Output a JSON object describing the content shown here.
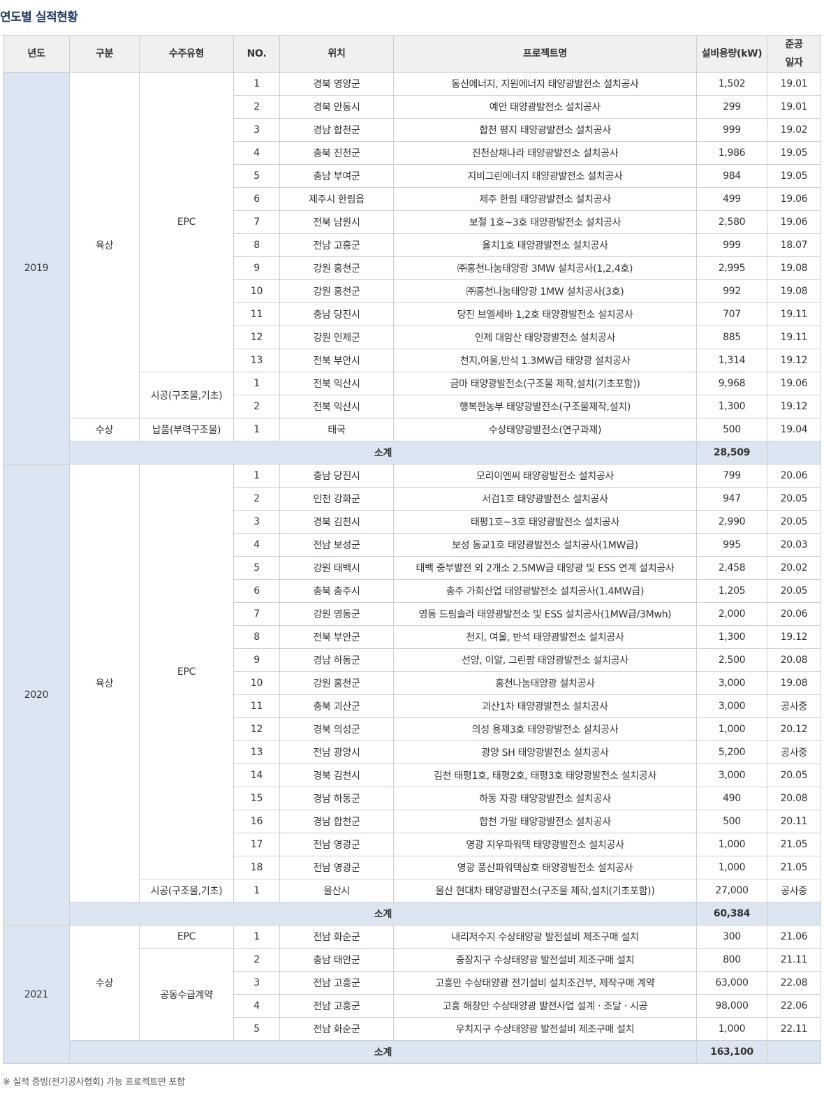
{
  "page": {
    "title": "연도별 실적현황",
    "footnote": "※ 실적 증빙(전기공사협회) 가능 프로젝트만 포함"
  },
  "header": [
    "년도",
    "구분",
    "수주유형",
    "NO.",
    "위치",
    "프로젝트명",
    "설비용량(kW)",
    "준공",
    "일자"
  ],
  "years": [
    {
      "year": "2019",
      "groups": [
        {
          "division": "육상",
          "types": [
            {
              "type": "EPC",
              "rows": [
                {
                  "no": "1",
                  "loc": "경북 영양군",
                  "name": "동신에너지, 지원에너지 태양광발전소 설치공사",
                  "cap": "1,502",
                  "date": "19.01"
                },
                {
                  "no": "2",
                  "loc": "경북 안동시",
                  "name": "예안 태양광발전소 설치공사",
                  "cap": "299",
                  "date": "19.01"
                },
                {
                  "no": "3",
                  "loc": "경남 합천군",
                  "name": "합천 평지 태양광발전소 설치공사",
                  "cap": "999",
                  "date": "19.02"
                },
                {
                  "no": "4",
                  "loc": "충북 진천군",
                  "name": "진천삼채나라 태양광발전소 설치공사",
                  "cap": "1,986",
                  "date": "19.05"
                },
                {
                  "no": "5",
                  "loc": "충남 부여군",
                  "name": "지비그린에너지 태양광발전소 설치공사",
                  "cap": "984",
                  "date": "19.05"
                },
                {
                  "no": "6",
                  "loc": "제주시 한림읍",
                  "name": "제주 한림 태양광발전소 설치공사",
                  "cap": "499",
                  "date": "19.06"
                },
                {
                  "no": "7",
                  "loc": "전북 남원시",
                  "name": "보절 1호~3호 태양광발전소 설치공사",
                  "cap": "2,580",
                  "date": "19.06"
                },
                {
                  "no": "8",
                  "loc": "전남 고흥군",
                  "name": "율치1호 태양광발전소 설치공사",
                  "cap": "999",
                  "date": "18.07"
                },
                {
                  "no": "9",
                  "loc": "강원 홍천군",
                  "name": "㈜홍천나눔태양광 3MW 설치공사(1,2,4호)",
                  "cap": "2,995",
                  "date": "19.08"
                },
                {
                  "no": "10",
                  "loc": "강원 홍천군",
                  "name": "㈜홍천나눔태양광 1MW 설치공사(3호)",
                  "cap": "992",
                  "date": "19.08"
                },
                {
                  "no": "11",
                  "loc": "충남 당진시",
                  "name": "당진 브엘세바 1,2호 태양광발전소 설치공사",
                  "cap": "707",
                  "date": "19.11"
                },
                {
                  "no": "12",
                  "loc": "강원 인제군",
                  "name": "인제 대암산 태양광발전소 설치공사",
                  "cap": "885",
                  "date": "19.11"
                },
                {
                  "no": "13",
                  "loc": "전북 부안시",
                  "name": "천지,여울,반석 1.3MW급 태양광 설치공사",
                  "cap": "1,314",
                  "date": "19.12"
                }
              ]
            },
            {
              "type": "시공(구조물,기초)",
              "rows": [
                {
                  "no": "1",
                  "loc": "전북 익산시",
                  "name": "금마 태양광발전소(구조물 제작,설치(기초포함))",
                  "cap": "9,968",
                  "date": "19.06"
                },
                {
                  "no": "2",
                  "loc": "전북 익산시",
                  "name": "행복한농부 태양광발전소(구조물제작,설치)",
                  "cap": "1,300",
                  "date": "19.12"
                }
              ]
            }
          ]
        },
        {
          "division": "수상",
          "types": [
            {
              "type": "납품(부력구조물)",
              "rows": [
                {
                  "no": "1",
                  "loc": "태국",
                  "name": "수상태양광발전소(연구과제)",
                  "cap": "500",
                  "date": "19.04"
                }
              ]
            }
          ]
        }
      ],
      "subtotal_label": "소계",
      "subtotal": "28,509"
    },
    {
      "year": "2020",
      "groups": [
        {
          "division": "육상",
          "types": [
            {
              "type": "EPC",
              "rows": [
                {
                  "no": "1",
                  "loc": "충남 당진시",
                  "name": "모리이엔씨 태양광발전소 설치공사",
                  "cap": "799",
                  "date": "20.06"
                },
                {
                  "no": "2",
                  "loc": "인천 강화군",
                  "name": "서검1호 태양광발전소 설치공사",
                  "cap": "947",
                  "date": "20.05"
                },
                {
                  "no": "3",
                  "loc": "경북 김천시",
                  "name": "태평1호~3호 태양광발전소 설치공사",
                  "cap": "2,990",
                  "date": "20.05"
                },
                {
                  "no": "4",
                  "loc": "전남 보성군",
                  "name": "보성 동교1호 태양광발전소 설치공사(1MW급)",
                  "cap": "995",
                  "date": "20.03"
                },
                {
                  "no": "5",
                  "loc": "강원 태백시",
                  "name": "태백 중부발전 외 2개소 2.5MW급 태양광 및 ESS 연계 설치공사",
                  "cap": "2,458",
                  "date": "20.02"
                },
                {
                  "no": "6",
                  "loc": "충북 충주시",
                  "name": "충주 가희산업 태양광발전소 설치공사(1.4MW급)",
                  "cap": "1,205",
                  "date": "20.05"
                },
                {
                  "no": "7",
                  "loc": "강원 영동군",
                  "name": "영동 드림솔라 태양광발전소 및 ESS 설치공사(1MW급/3Mwh)",
                  "cap": "2,000",
                  "date": "20.06"
                },
                {
                  "no": "8",
                  "loc": "전북 부안군",
                  "name": "천지, 여울, 반석 태양광발전소 설치공사",
                  "cap": "1,300",
                  "date": "19.12"
                },
                {
                  "no": "9",
                  "loc": "경남 하동군",
                  "name": "선양, 이알, 그린팜 태양광발전소 설치공사",
                  "cap": "2,500",
                  "date": "20.08"
                },
                {
                  "no": "10",
                  "loc": "강원 홍천군",
                  "name": "홍천나눔태양광 설치공사",
                  "cap": "3,000",
                  "date": "19.08"
                },
                {
                  "no": "11",
                  "loc": "충북 괴산군",
                  "name": "괴산1차 태양광발전소 설치공사",
                  "cap": "3,000",
                  "date": "공사중"
                },
                {
                  "no": "12",
                  "loc": "경북 의성군",
                  "name": "의성 용제3호 태양광발전소 설치공사",
                  "cap": "1,000",
                  "date": "20.12"
                },
                {
                  "no": "13",
                  "loc": "전남 광양시",
                  "name": "광양 SH 태양광발전소 설치공사",
                  "cap": "5,200",
                  "date": "공사중"
                },
                {
                  "no": "14",
                  "loc": "경북 김천시",
                  "name": "김천 태평1호, 태평2호, 태평3호 태양광발전소 설치공사",
                  "cap": "3,000",
                  "date": "20.05"
                },
                {
                  "no": "15",
                  "loc": "경남 하동군",
                  "name": "하동 자광 태양광발전소 설치공사",
                  "cap": "490",
                  "date": "20.08"
                },
                {
                  "no": "16",
                  "loc": "경남 합천군",
                  "name": "합천 가말 태양광발전소 설치공사",
                  "cap": "500",
                  "date": "20.11"
                },
                {
                  "no": "17",
                  "loc": "전남 영광군",
                  "name": "영광 지우파워텍 태양광발전소 설치공사",
                  "cap": "1,000",
                  "date": "21.05"
                },
                {
                  "no": "18",
                  "loc": "전남 영광군",
                  "name": "영광 풍산파워텍삼호 태양광발전소 설치공사",
                  "cap": "1,000",
                  "date": "21.05"
                }
              ]
            },
            {
              "type": "시공(구조물,기초)",
              "rows": [
                {
                  "no": "1",
                  "loc": "울산시",
                  "name": "울산 현대차 태양광발전소(구조물 제작,설치(기초포함))",
                  "cap": "27,000",
                  "date": "공사중"
                }
              ]
            }
          ]
        }
      ],
      "subtotal_label": "소계",
      "subtotal": "60,384"
    },
    {
      "year": "2021",
      "groups": [
        {
          "division": "수상",
          "types": [
            {
              "type": "EPC",
              "rows": [
                {
                  "no": "1",
                  "loc": "전남 화순군",
                  "name": "내리저수지 수상태양광 발전설비 제조구매 설치",
                  "cap": "300",
                  "date": "21.06"
                }
              ]
            },
            {
              "type": "공동수급계약",
              "rows": [
                {
                  "no": "2",
                  "loc": "충남 태안군",
                  "name": "중장지구 수상태양광 발전설비 제조구매 설치",
                  "cap": "800",
                  "date": "21.11"
                },
                {
                  "no": "3",
                  "loc": "전남 고흥군",
                  "name": "고흥만 수상태양광 전기설비 설치조건부, 제작구매 계약",
                  "cap": "63,000",
                  "date": "22.08"
                },
                {
                  "no": "4",
                  "loc": "전남 고흥군",
                  "name": "고흥 해창만 수상태양광 발전사업 설계ㆍ조달ㆍ시공",
                  "cap": "98,000",
                  "date": "22.06"
                },
                {
                  "no": "5",
                  "loc": "전남 화순군",
                  "name": "우치지구 수상태양광 발전설비 제조구매 설치",
                  "cap": "1,000",
                  "date": "22.11"
                }
              ]
            }
          ]
        }
      ],
      "subtotal_label": "소계",
      "subtotal": "163,100"
    }
  ]
}
